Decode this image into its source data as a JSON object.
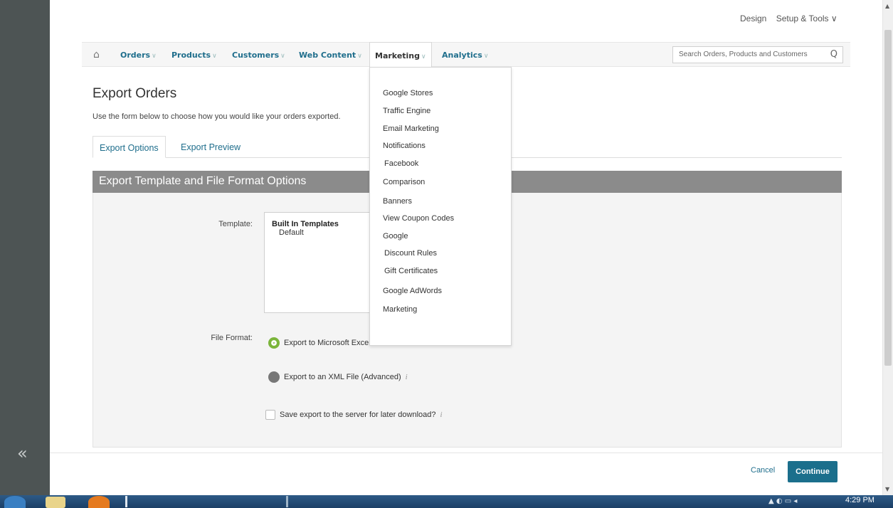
{
  "sidebar": {
    "collapse_icon": "«"
  },
  "topbar": {
    "design": "Design",
    "setup_tools": "Setup & Tools ∨"
  },
  "nav": {
    "home_icon": "⌂",
    "items": [
      {
        "label": "Orders",
        "chev": "∨"
      },
      {
        "label": "Products",
        "chev": "∨"
      },
      {
        "label": "Customers",
        "chev": "∨"
      },
      {
        "label": "Web Content",
        "chev": "∨"
      },
      {
        "label": "Marketing",
        "chev": "∨"
      },
      {
        "label": "Analytics",
        "chev": "∨"
      }
    ],
    "search_placeholder": "Search Orders, Products and Customers",
    "search_icon": "Q"
  },
  "page": {
    "title": "Export Orders",
    "description": "Use the form below to choose how you would like your orders exported. "
  },
  "tabs": [
    {
      "label": "Export Options"
    },
    {
      "label": "Export Preview"
    }
  ],
  "section": {
    "heading": "Export Template and File Format Options",
    "template_label": "Template:",
    "template_group": "Built In Templates",
    "template_option": "Default",
    "file_format_label": "File Format:",
    "radio_excel": "Export to Microsoft Exce",
    "radio_xml": "Export to an XML File (Advanced)",
    "checkbox_label": "Save export to the server for later download?",
    "info_icon": "i"
  },
  "marketing_menu": [
    "Google Stores",
    "Traffic Engine",
    "Email Marketing",
    "Notifications",
    "Facebook",
    "Comparison",
    "Banners",
    "View Coupon Codes",
    "Google",
    "Discount Rules",
    "Gift Certificates",
    "Google AdWords",
    "Marketing"
  ],
  "footer": {
    "cancel": "Cancel",
    "continue": "Continue"
  },
  "taskbar": {
    "time": "4:29 PM"
  }
}
